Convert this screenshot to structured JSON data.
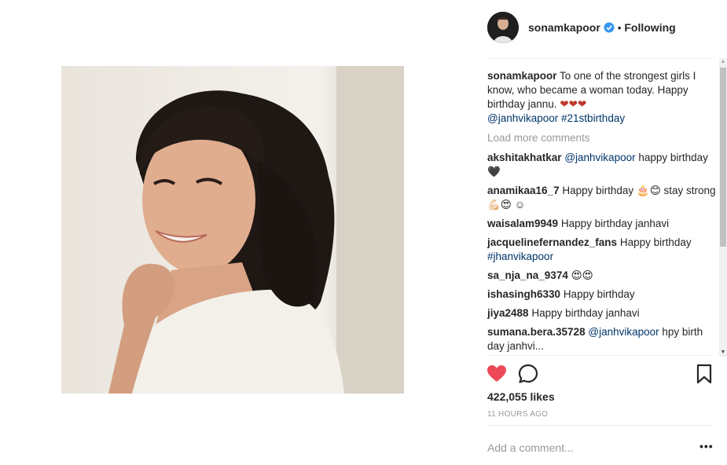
{
  "post": {
    "username": "sonamkapoor",
    "separator": "•",
    "follow_status": "Following"
  },
  "caption": {
    "username": "sonamkapoor",
    "text": "To one of the strongest girls I know, who became a woman today. Happy birthday jannu.",
    "emoji": "❤❤❤",
    "mention": "@janhvikapoor",
    "hashtag": "#21stbirthday"
  },
  "load_more": "Load more comments",
  "comments": [
    {
      "user": "akshitakhatkar",
      "mention": "@janhvikapoor",
      "text": "happy birthday 🖤"
    },
    {
      "user": "anamikaa16_7",
      "mention": "",
      "text": "Happy birthday 🎂😊 stay strong 💪🏻😍 ☺"
    },
    {
      "user": "waisalam9949",
      "mention": "",
      "text": "Happy birthday janhavi"
    },
    {
      "user": "jacquelinefernandez_fans",
      "mention": "",
      "text": "Happy birthday",
      "link": "#jhanvikapoor"
    },
    {
      "user": "sa_nja_na_9374",
      "mention": "",
      "text": "😍😍"
    },
    {
      "user": "ishasingh6330",
      "mention": "",
      "text": "Happy birthday"
    },
    {
      "user": "jiya2488",
      "mention": "",
      "text": "Happy birthday janhavi"
    },
    {
      "user": "sumana.bera.35728",
      "mention": "@janhvikapoor",
      "text": "hpy birth day janhvi..."
    }
  ],
  "likes": "422,055 likes",
  "timestamp": "11 HOURS AGO",
  "add_comment_placeholder": "Add a comment...",
  "more_options": "•••",
  "icons": {
    "like": "heart-icon",
    "comment": "comment-icon",
    "save": "bookmark-icon",
    "verified": "verified-badge-icon"
  },
  "colors": {
    "like_red": "#ed4956",
    "link_blue": "#003569",
    "verified_blue": "#3897f0",
    "muted_gray": "#999999"
  }
}
